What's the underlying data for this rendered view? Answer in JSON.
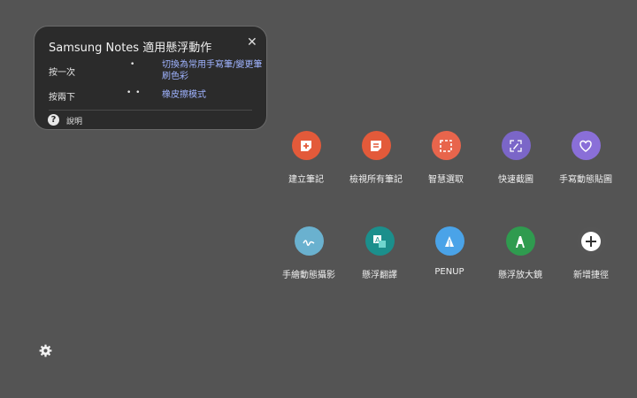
{
  "popup": {
    "title": "Samsung Notes 適用懸浮動作",
    "close_glyph": "✕",
    "rows": [
      {
        "label": "按一次",
        "gesture": "•",
        "action": "切換為常用手寫筆/變更筆刷色彩"
      },
      {
        "label": "按兩下",
        "gesture": "• •",
        "action": "橡皮擦模式"
      }
    ],
    "help_label": "說明"
  },
  "actions": [
    {
      "label": "建立筆記",
      "icon": "create-note-icon",
      "color": "#e35a3a"
    },
    {
      "label": "檢視所有筆記",
      "icon": "view-notes-icon",
      "color": "#e35a3a"
    },
    {
      "label": "智慧選取",
      "icon": "smart-select-icon",
      "color": "#e8654c"
    },
    {
      "label": "快速截圖",
      "icon": "screen-write-icon",
      "color": "#7b66c8"
    },
    {
      "label": "手寫動態貼圖",
      "icon": "live-message-icon",
      "color": "#8a6fd8"
    },
    {
      "label": "手繪動態攝影",
      "icon": "ar-doodle-icon",
      "color": "#6ab1cf"
    },
    {
      "label": "懸浮翻譯",
      "icon": "translate-icon",
      "color": "#1b8f8c"
    },
    {
      "label": "PENUP",
      "icon": "penup-icon",
      "color": "#4aa3e8"
    },
    {
      "label": "懸浮放大鏡",
      "icon": "magnify-icon",
      "color": "#2f9b4f"
    },
    {
      "label": "新增捷徑",
      "icon": "add-icon",
      "color": "#555555"
    }
  ]
}
